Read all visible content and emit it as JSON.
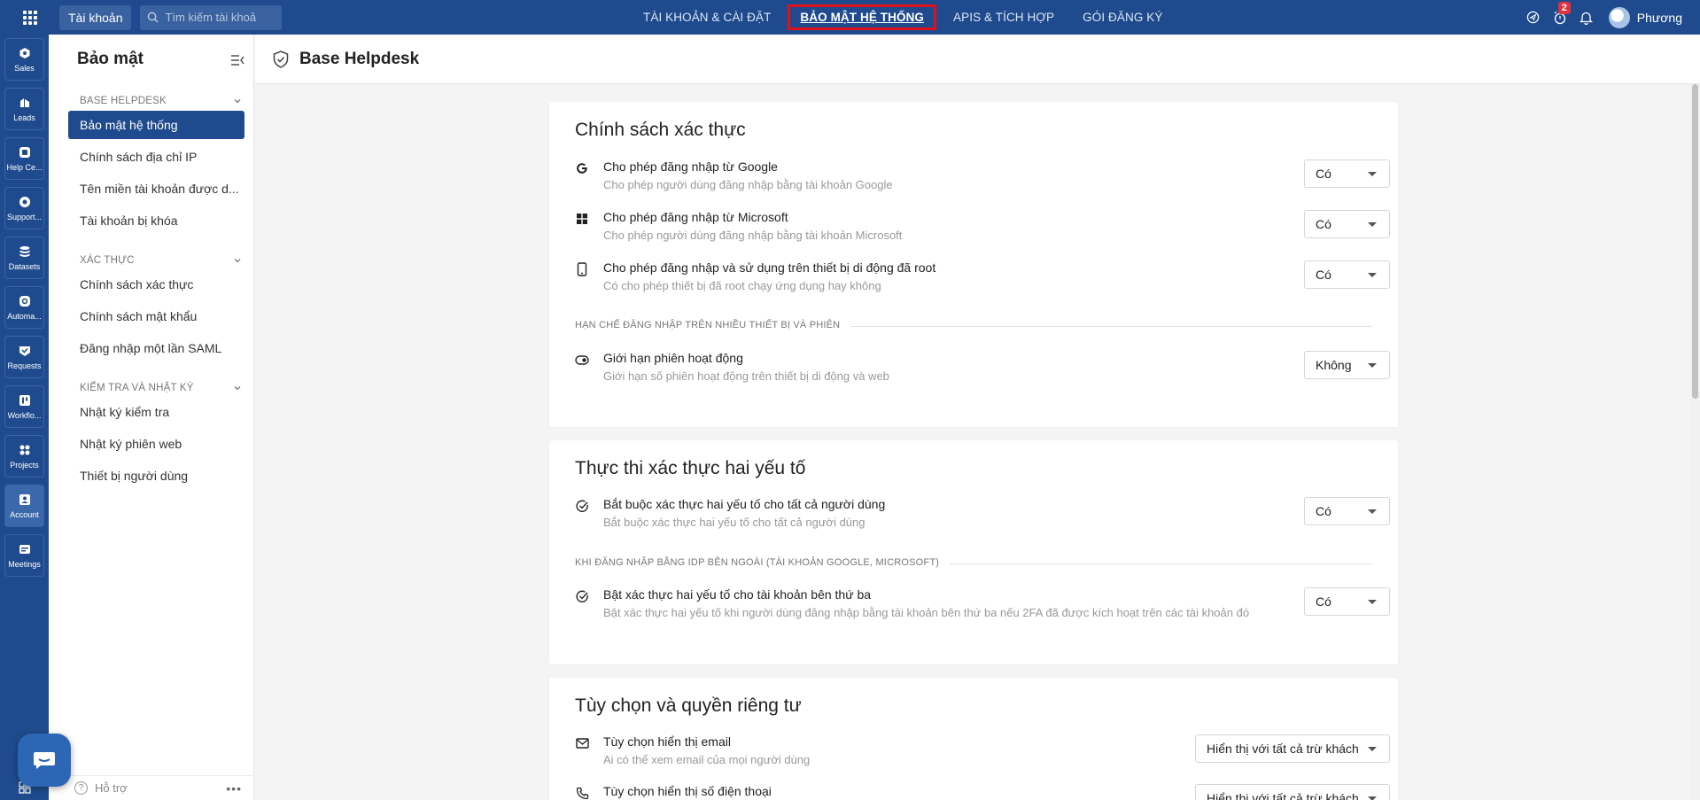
{
  "topbar": {
    "account_label": "Tài khoản",
    "search_placeholder": "Tìm kiếm tài khoả",
    "nav": [
      "TÀI KHOẢN & CÀI ĐẶT",
      "BẢO MẬT HỆ THỐNG",
      "APIS & TÍCH HỢP",
      "GÓI ĐĂNG KÝ"
    ],
    "active_nav": "BẢO MẬT HỆ THỐNG",
    "notification_count": "2",
    "user_name": "Phương"
  },
  "rail": {
    "items": [
      {
        "label": "Sales",
        "icon": "sales-icon"
      },
      {
        "label": "Leads",
        "icon": "leads-icon"
      },
      {
        "label": "Help Ce...",
        "icon": "help-center-icon"
      },
      {
        "label": "Support...",
        "icon": "support-icon"
      },
      {
        "label": "Datasets",
        "icon": "datasets-icon"
      },
      {
        "label": "Automa...",
        "icon": "automation-icon"
      },
      {
        "label": "Requests",
        "icon": "requests-icon"
      },
      {
        "label": "Workflo...",
        "icon": "workflow-icon"
      },
      {
        "label": "Projects",
        "icon": "projects-icon"
      },
      {
        "label": "Account",
        "icon": "account-icon"
      },
      {
        "label": "Meetings",
        "icon": "meetings-icon"
      }
    ],
    "active": "Account"
  },
  "sidebar": {
    "title": "Bảo mật",
    "sections": [
      {
        "label": "BASE HELPDESK",
        "items": [
          "Bảo mật hệ thống",
          "Chính sách địa chỉ IP",
          "Tên miền tài khoản được d...",
          "Tài khoản bị khóa"
        ]
      },
      {
        "label": "XÁC THỰC",
        "items": [
          "Chính sách xác thực",
          "Chính sách mật khẩu",
          "Đăng nhập một lần SAML"
        ]
      },
      {
        "label": "KIỂM TRA VÀ NHẬT KÝ",
        "items": [
          "Nhật ký kiểm tra",
          "Nhật ký phiên web",
          "Thiết bị người dùng"
        ]
      }
    ],
    "active_item": "Bảo mật hệ thống",
    "footer_label": "Hỗ trợ"
  },
  "page": {
    "title": "Base Helpdesk"
  },
  "cards": [
    {
      "title": "Chính sách xác thực",
      "rows": [
        {
          "icon": "google-icon",
          "title": "Cho phép đăng nhập từ Google",
          "desc": "Cho phép người dùng đăng nhập bằng tài khoản Google",
          "value": "Có"
        },
        {
          "icon": "microsoft-icon",
          "title": "Cho phép đăng nhập từ Microsoft",
          "desc": "Cho phép người dùng đăng nhập bằng tài khoản Microsoft",
          "value": "Có"
        },
        {
          "icon": "mobile-device-icon",
          "title": "Cho phép đăng nhập và sử dụng trên thiết bị di động đã root",
          "desc": "Có cho phép thiết bị đã root chạy ứng dụng hay không",
          "value": "Có"
        },
        {
          "icon": "toggle-icon",
          "title": "Giới hạn phiên hoạt động",
          "desc": "Giới hạn số phiên hoạt động trên thiết bị di động và web",
          "value": "Không"
        }
      ],
      "divider": "HẠN CHẾ ĐĂNG NHẬP TRÊN NHIỀU THIẾT BỊ VÀ PHIÊN"
    },
    {
      "title": "Thực thi xác thực hai yếu tố",
      "rows": [
        {
          "icon": "check-circle-icon",
          "title": "Bắt buộc xác thực hai yếu tố cho tất cả người dùng",
          "desc": "Bắt buộc xác thực hai yếu tố cho tất cả người dùng",
          "value": "Có"
        },
        {
          "icon": "check-circle-icon",
          "title": "Bật xác thực hai yếu tố cho tài khoản bên thứ ba",
          "desc": "Bật xác thực hai yếu tố khi người dùng đăng nhập bằng tài khoản bên thứ ba nếu 2FA đã được kích hoạt trên các tài khoản đó",
          "value": "Có"
        }
      ],
      "divider": "KHI ĐĂNG NHẬP BẰNG IDP BÊN NGOÀI (TÀI KHOẢN GOOGLE, MICROSOFT)"
    },
    {
      "title": "Tùy chọn và quyền riêng tư",
      "rows": [
        {
          "icon": "email-icon",
          "title": "Tùy chọn hiển thị email",
          "desc": "Ai có thể xem email của mọi người dùng",
          "value": "Hiển thị với tất cả trừ khách"
        },
        {
          "icon": "phone-icon",
          "title": "Tùy chọn hiển thị số điện thoại",
          "desc": "",
          "value": "Hiển thị với tất cả trừ khách"
        }
      ]
    }
  ],
  "colors": {
    "primary": "#1f4b8e",
    "highlight_border": "#e0101b",
    "badge": "#e0333b",
    "background": "#f4f4f4"
  }
}
